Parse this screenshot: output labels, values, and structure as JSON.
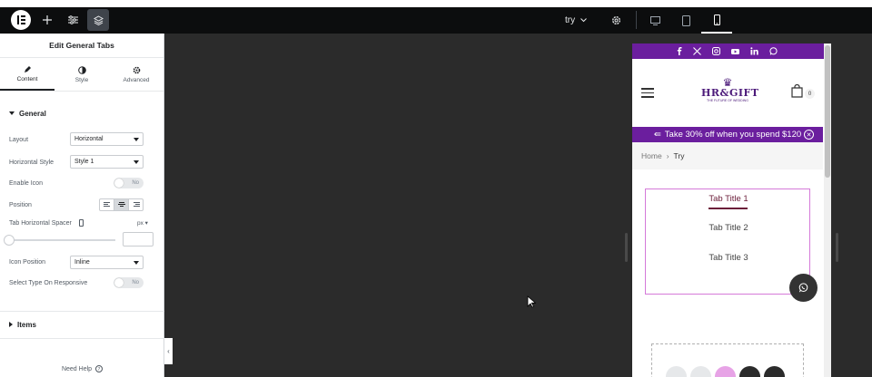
{
  "topbar": {
    "site_name": "try",
    "icons": [
      "elementor-logo-icon",
      "plus-icon",
      "sliders-icon",
      "layers-icon",
      "chevron-down-icon",
      "gear-icon",
      "desktop-icon",
      "tablet-icon",
      "mobile-icon"
    ]
  },
  "panel": {
    "title": "Edit General Tabs",
    "tabs": [
      {
        "label": "Content",
        "icon": "pencil-icon"
      },
      {
        "label": "Style",
        "icon": "half-circle-icon"
      },
      {
        "label": "Advanced",
        "icon": "gear-icon"
      }
    ],
    "general_section": "General",
    "controls": {
      "layout_label": "Layout",
      "layout_value": "Horizontal",
      "horizontal_style_label": "Horizontal Style",
      "horizontal_style_value": "Style 1",
      "enable_icon_label": "Enable Icon",
      "enable_icon_value": "No",
      "position_label": "Position",
      "spacer_label": "Tab Horizontal Spacer",
      "spacer_unit": "px",
      "icon_position_label": "Icon Position",
      "icon_position_value": "Inline",
      "responsive_label": "Select Type On Responsive",
      "responsive_value": "No"
    },
    "items_section": "Items",
    "need_help": "Need Help"
  },
  "preview": {
    "promo_text": "Take 30% off when you spend $120",
    "logo_text": "HR&GIFT",
    "logo_tagline": "THE FUTURE OF WEDDING",
    "cart_count": "0",
    "breadcrumb_home": "Home",
    "breadcrumb_current": "Try",
    "tab_titles": [
      "Tab Title 1",
      "Tab Title 2",
      "Tab Title 3"
    ],
    "brand_color": "#6b1e9e",
    "social_icons": [
      "facebook-icon",
      "x-icon",
      "instagram-icon",
      "youtube-icon",
      "linkedin-icon",
      "whatsapp-icon"
    ]
  }
}
